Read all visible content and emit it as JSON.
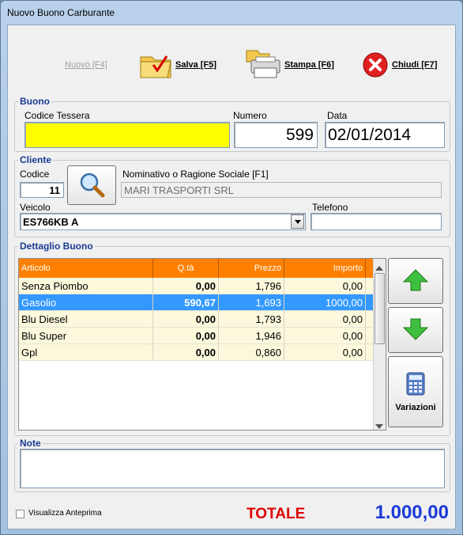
{
  "window": {
    "title": "Nuovo Buono Carburante"
  },
  "toolbar": {
    "nuovo": "Nuovo [F4]",
    "salva": "Salva [F5]",
    "stampa": "Stampa [F6]",
    "chiudi": "Chiudi [F7]"
  },
  "buono": {
    "title": "Buono",
    "codice_tessera_label": "Codice Tessera",
    "codice_tessera_value": "",
    "numero_label": "Numero",
    "numero_value": "599",
    "data_label": "Data",
    "data_value": "02/01/2014"
  },
  "cliente": {
    "title": "Cliente",
    "codice_label": "Codice",
    "codice_value": "11",
    "nominativo_label": "Nominativo o Ragione Sociale [F1]",
    "nominativo_value": "MARI TRASPORTI SRL",
    "veicolo_label": "Veicolo",
    "veicolo_value": "ES766KB A",
    "telefono_label": "Telefono",
    "telefono_value": ""
  },
  "dettaglio": {
    "title": "Dettaglio Buono",
    "columns": [
      "Articolo",
      "Q.tà",
      "Prezzo",
      "Importo"
    ],
    "rows": [
      {
        "articolo": "Senza Piombo",
        "qta": "0,00",
        "prezzo": "1,796",
        "importo": "0,00"
      },
      {
        "articolo": "Gasolio",
        "qta": "590,67",
        "prezzo": "1,693",
        "importo": "1000,00"
      },
      {
        "articolo": "Blu Diesel",
        "qta": "0,00",
        "prezzo": "1,793",
        "importo": "0,00"
      },
      {
        "articolo": "Blu Super",
        "qta": "0,00",
        "prezzo": "1,946",
        "importo": "0,00"
      },
      {
        "articolo": "Gpl",
        "qta": "0,00",
        "prezzo": "0,860",
        "importo": "0,00"
      }
    ],
    "variazioni_label": "Variazioni"
  },
  "note": {
    "title": "Note",
    "value": ""
  },
  "footer": {
    "anteprima_label": "Visualizza Anteprima",
    "totale_label": "TOTALE",
    "totale_value": "1.000,00"
  },
  "colors": {
    "accent": "#ff8000",
    "selection": "#3399ff",
    "total": "#1a3ad8",
    "total_label": "#e00000"
  }
}
